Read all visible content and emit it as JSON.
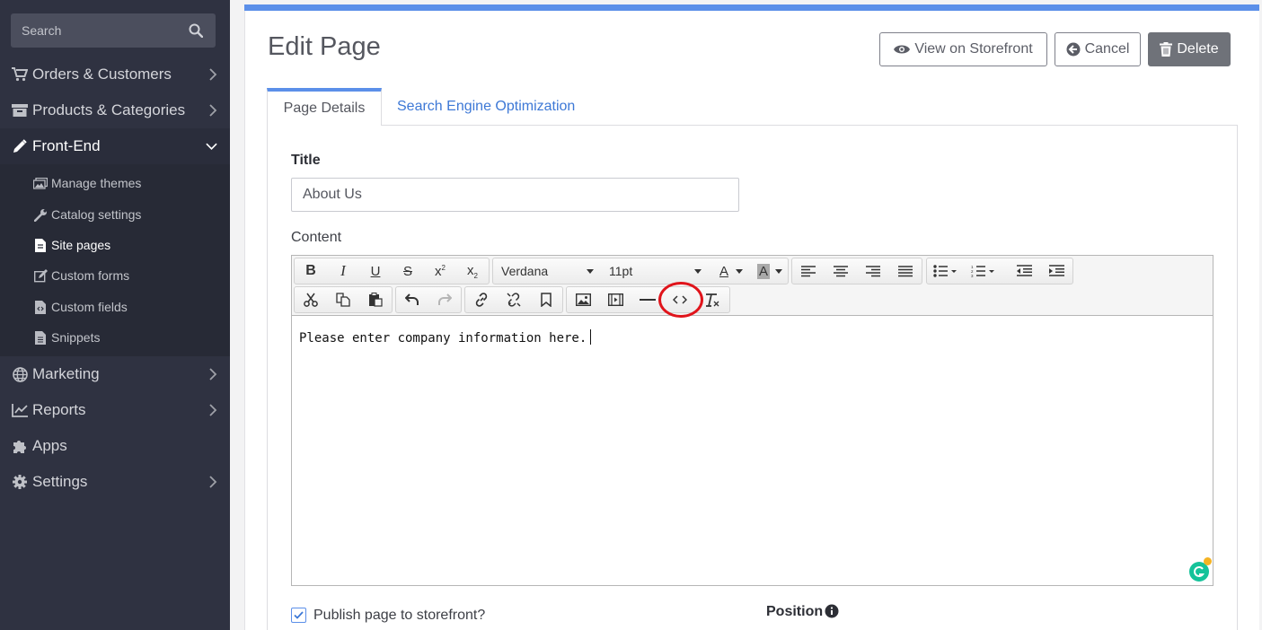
{
  "sidebar": {
    "search_placeholder": "Search",
    "nav": [
      {
        "label": "Orders & Customers",
        "icon": "cart-icon"
      },
      {
        "label": "Products & Categories",
        "icon": "archive-icon"
      },
      {
        "label": "Front-End",
        "icon": "pencil-icon",
        "expanded": true
      },
      {
        "label": "Marketing",
        "icon": "globe-icon"
      },
      {
        "label": "Reports",
        "icon": "chart-line-icon"
      },
      {
        "label": "Apps",
        "icon": "puzzle-icon"
      },
      {
        "label": "Settings",
        "icon": "gear-icon"
      }
    ],
    "sub": [
      {
        "label": "Manage themes",
        "icon": "images-icon"
      },
      {
        "label": "Catalog settings",
        "icon": "wrench-icon"
      },
      {
        "label": "Site pages",
        "icon": "file-icon",
        "active": true
      },
      {
        "label": "Custom forms",
        "icon": "edit-form-icon"
      },
      {
        "label": "Custom fields",
        "icon": "file-code-icon"
      },
      {
        "label": "Snippets",
        "icon": "file-text-icon"
      }
    ]
  },
  "header": {
    "title": "Edit Page",
    "view_label": "View on Storefront",
    "cancel_label": "Cancel",
    "delete_label": "Delete"
  },
  "tabs": [
    {
      "label": "Page Details",
      "active": true
    },
    {
      "label": "Search Engine Optimization",
      "active": false
    }
  ],
  "form": {
    "title_label": "Title",
    "title_value": "About Us",
    "content_label": "Content",
    "publish_label": "Publish page to storefront?",
    "publish_checked": true,
    "position_label": "Position"
  },
  "editor": {
    "font_family": "Verdana",
    "font_size": "11pt",
    "content": "Please enter company information here."
  },
  "colors": {
    "accent": "#5b8fe9",
    "sidebar_bg": "#2f3241",
    "highlight": "#e0141b"
  }
}
